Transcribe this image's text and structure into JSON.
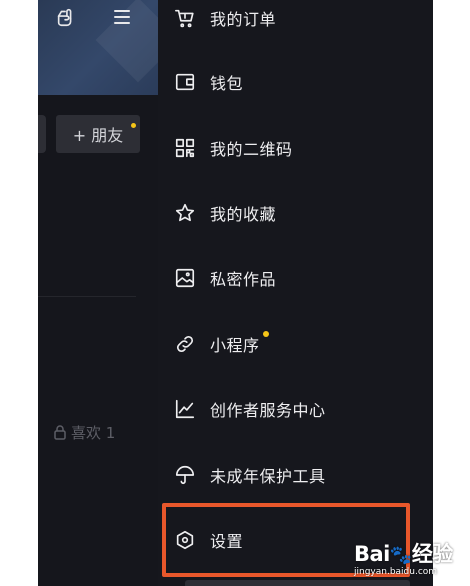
{
  "background_page": {
    "add_friend_label": "+ 朋友",
    "likes_label": "喜欢 1"
  },
  "drawer": {
    "items": [
      {
        "label": "我的订单",
        "icon": "cart-icon"
      },
      {
        "label": "钱包",
        "icon": "wallet-icon"
      },
      {
        "label": "我的二维码",
        "icon": "qr-code-icon"
      },
      {
        "label": "我的收藏",
        "icon": "star-icon"
      },
      {
        "label": "私密作品",
        "icon": "private-photo-icon"
      },
      {
        "label": "小程序",
        "icon": "link-icon",
        "badge": true
      },
      {
        "label": "创作者服务中心",
        "icon": "chart-icon"
      },
      {
        "label": "未成年保护工具",
        "icon": "umbrella-icon"
      },
      {
        "label": "设置",
        "icon": "settings-hexagon-icon",
        "highlighted": true
      }
    ]
  },
  "colors": {
    "background": "#16171d",
    "text": "#eeeef0",
    "badge": "#f5c518",
    "highlight_border": "#e8572b"
  },
  "watermark": {
    "logo": "Bai du 经验",
    "url": "jingyan.baidu.com"
  }
}
